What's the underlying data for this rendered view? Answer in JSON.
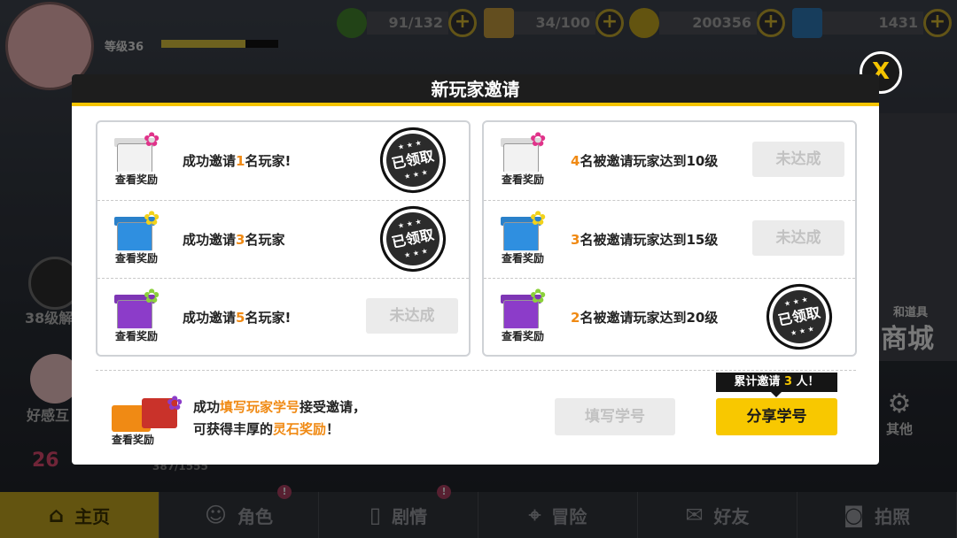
{
  "hud": {
    "level_label": "等级36",
    "level_progress": 0.72,
    "stamina": "91/132",
    "tickets": "34/100",
    "gold": "200356",
    "crystals": "1431",
    "plus": "+"
  },
  "background": {
    "left_unlock": "38级解",
    "left_affection": "好感互",
    "left_number": "26",
    "left_exp": "387/1555",
    "right_shop_small": "和道具",
    "right_shop": "商城",
    "right_other": "其他"
  },
  "nav": [
    {
      "label": "主页",
      "icon": "⌂",
      "active": true,
      "badge": ""
    },
    {
      "label": "角色",
      "icon": "☺",
      "active": false,
      "badge": "!"
    },
    {
      "label": "剧情",
      "icon": "▯",
      "active": false,
      "badge": "!"
    },
    {
      "label": "冒险",
      "icon": "⌖",
      "active": false,
      "badge": ""
    },
    {
      "label": "好友",
      "icon": "✉",
      "active": false,
      "badge": ""
    },
    {
      "label": "拍照",
      "icon": "◙",
      "active": false,
      "badge": ""
    }
  ],
  "dialog": {
    "title": "新玩家邀请",
    "close": "X",
    "view_reward": "查看奖励",
    "left": [
      {
        "pre": "成功邀请",
        "num": "1",
        "post": "名玩家!",
        "status": "claimed",
        "status_label": "已领取",
        "gift_color": "#f2f2f2",
        "bow_color": "#e0338a"
      },
      {
        "pre": "成功邀请",
        "num": "3",
        "post": "名玩家",
        "status": "claimed",
        "status_label": "已领取",
        "gift_color": "#2f8fe0",
        "bow_color": "#f2d21a"
      },
      {
        "pre": "成功邀请",
        "num": "5",
        "post": "名玩家!",
        "status": "pending",
        "status_label": "未达成",
        "gift_color": "#8c3cc9",
        "bow_color": "#8bd13a"
      }
    ],
    "right": [
      {
        "pre": "",
        "num": "4",
        "post": "名被邀请玩家达到10级",
        "status": "pending",
        "status_label": "未达成",
        "gift_color": "#f2f2f2",
        "bow_color": "#e0338a"
      },
      {
        "pre": "",
        "num": "3",
        "post": "名被邀请玩家达到15级",
        "status": "pending",
        "status_label": "未达成",
        "gift_color": "#2f8fe0",
        "bow_color": "#f2d21a"
      },
      {
        "pre": "",
        "num": "2",
        "post": "名被邀请玩家达到20级",
        "status": "claimed",
        "status_label": "已领取",
        "gift_color": "#8c3cc9",
        "bow_color": "#8bd13a"
      }
    ],
    "footer": {
      "line1_a": "成功",
      "line1_hl": "填写玩家学号",
      "line1_b": "接受邀请，",
      "line2_a": "可获得丰厚的",
      "line2_hl": "灵石奖励",
      "line2_b": "！",
      "fill_button": "填写学号",
      "share_button": "分享学号",
      "tip_a": "累计邀请",
      "tip_num": "3",
      "tip_b": "人！"
    }
  }
}
